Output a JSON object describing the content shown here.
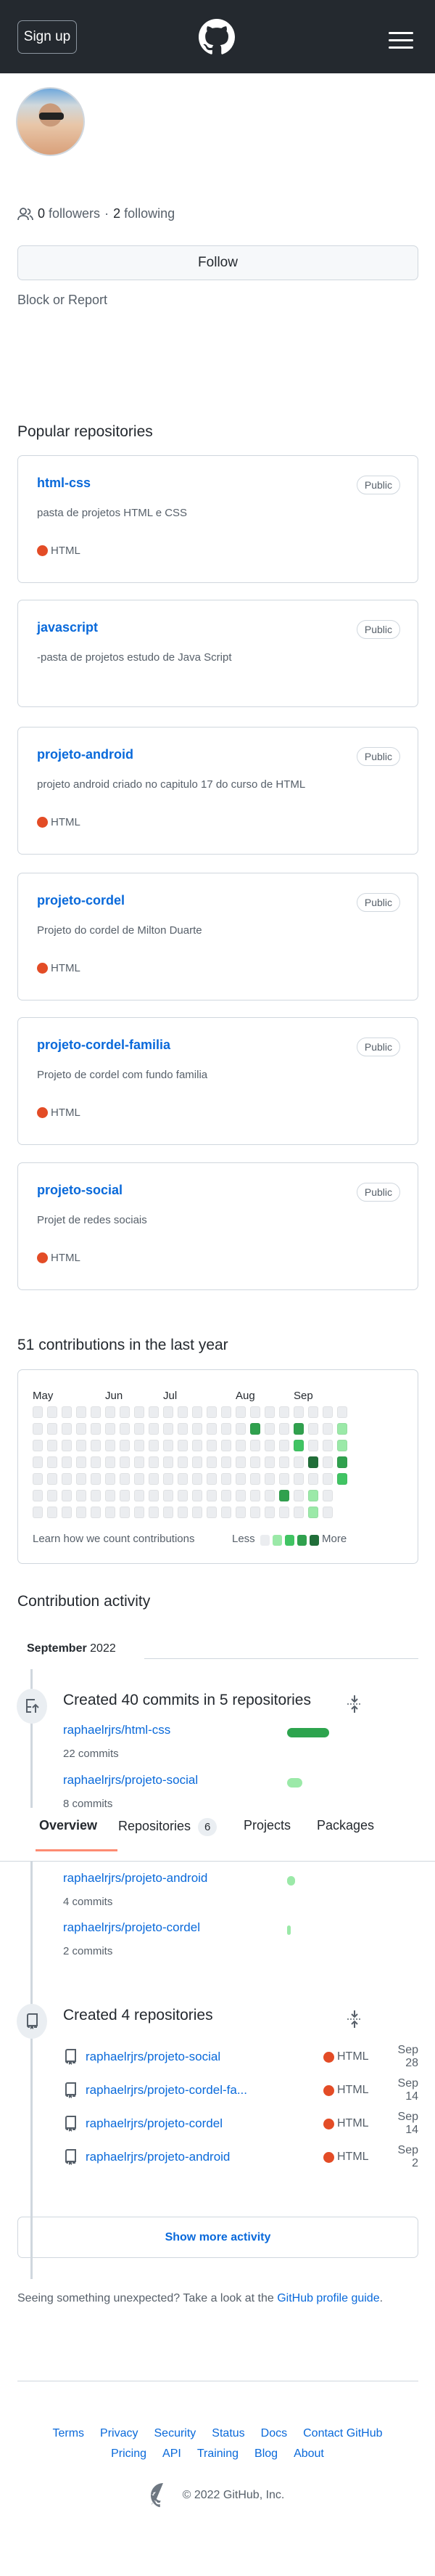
{
  "header": {
    "signup_label": "Sign up",
    "logo_icon": "github-mark-icon",
    "menu_icon": "hamburger-icon"
  },
  "profile": {
    "followers_count": "0",
    "followers_label": "followers",
    "separator": "·",
    "following_count": "2",
    "following_label": "following",
    "follow_label": "Follow",
    "block_label": "Block or Report"
  },
  "popular": {
    "title": "Popular repositories",
    "repos": [
      {
        "name": "html-css",
        "visibility": "Public",
        "description": "pasta de projetos HTML e CSS",
        "language": "HTML"
      },
      {
        "name": "javascript",
        "visibility": "Public",
        "description": "-pasta de projetos estudo de Java Script",
        "language": null
      },
      {
        "name": "projeto-android",
        "visibility": "Public",
        "description": "projeto android criado no capitulo 17 do curso de HTML",
        "language": "HTML"
      },
      {
        "name": "projeto-cordel",
        "visibility": "Public",
        "description": "Projeto do cordel de Milton Duarte",
        "language": "HTML"
      },
      {
        "name": "projeto-cordel-familia",
        "visibility": "Public",
        "description": "Projeto de cordel com fundo familia",
        "language": "HTML"
      },
      {
        "name": "projeto-social",
        "visibility": "Public",
        "description": "Projet de redes sociais",
        "language": "HTML"
      }
    ],
    "language_color": "#e34c26"
  },
  "contributions": {
    "title": "51 contributions in the last year",
    "months": [
      {
        "label": "May",
        "week": 0
      },
      {
        "label": "Jun",
        "week": 5
      },
      {
        "label": "Jul",
        "week": 9
      },
      {
        "label": "Aug",
        "week": 14
      },
      {
        "label": "Sep",
        "week": 18
      }
    ],
    "weeks": 22,
    "last_week_days": 5,
    "active_days": [
      {
        "week": 15,
        "day": 1,
        "level": 3
      },
      {
        "week": 17,
        "day": 5,
        "level": 3
      },
      {
        "week": 18,
        "day": 1,
        "level": 3
      },
      {
        "week": 18,
        "day": 2,
        "level": 2
      },
      {
        "week": 19,
        "day": 3,
        "level": 4
      },
      {
        "week": 19,
        "day": 5,
        "level": 1
      },
      {
        "week": 19,
        "day": 6,
        "level": 1
      },
      {
        "week": 21,
        "day": 1,
        "level": 1
      },
      {
        "week": 21,
        "day": 2,
        "level": 1
      },
      {
        "week": 21,
        "day": 3,
        "level": 3
      },
      {
        "week": 21,
        "day": 4,
        "level": 2
      }
    ],
    "level_colors": [
      "#ebedf0",
      "#9be9a8",
      "#40c463",
      "#30a14e",
      "#216e39"
    ],
    "learn_label": "Learn how we count contributions",
    "less_label": "Less",
    "more_label": "More"
  },
  "activity": {
    "title": "Contribution activity",
    "month": "September",
    "year": "2022",
    "commits_title": "Created 40 commits in 5 repositories",
    "commit_repos": [
      {
        "repo": "raphaelrjrs/html-css",
        "commits": "22 commits",
        "count": 22
      },
      {
        "repo": "raphaelrjrs/projeto-social",
        "commits": "8 commits",
        "count": 8
      },
      {
        "repo": "raphaelrjrs/projeto-android",
        "commits": "4 commits",
        "count": 4
      },
      {
        "repo": "raphaelrjrs/projeto-cordel",
        "commits": "2 commits",
        "count": 2
      }
    ],
    "created_title": "Created 4 repositories",
    "created_repos": [
      {
        "repo": "raphaelrjrs/projeto-social",
        "language": "HTML",
        "date": "Sep 28"
      },
      {
        "repo": "raphaelrjrs/projeto-cordel-fa...",
        "language": "HTML",
        "date": "Sep 14"
      },
      {
        "repo": "raphaelrjrs/projeto-cordel",
        "language": "HTML",
        "date": "Sep 14"
      },
      {
        "repo": "raphaelrjrs/projeto-android",
        "language": "HTML",
        "date": "Sep 2"
      }
    ],
    "show_more_label": "Show more activity",
    "unexpected_text": "Seeing something unexpected? Take a look at the ",
    "guide_link": "GitHub profile guide",
    "guide_end": "."
  },
  "tabs": [
    {
      "label": "Overview",
      "active": true
    },
    {
      "label": "Repositories",
      "count": "6"
    },
    {
      "label": "Projects"
    },
    {
      "label": "Packages"
    }
  ],
  "footer": {
    "row1": [
      "Terms",
      "Privacy",
      "Security",
      "Status",
      "Docs",
      "Contact GitHub"
    ],
    "row2": [
      "Pricing",
      "API",
      "Training",
      "Blog",
      "About"
    ],
    "copyright": "© 2022 GitHub, Inc."
  }
}
